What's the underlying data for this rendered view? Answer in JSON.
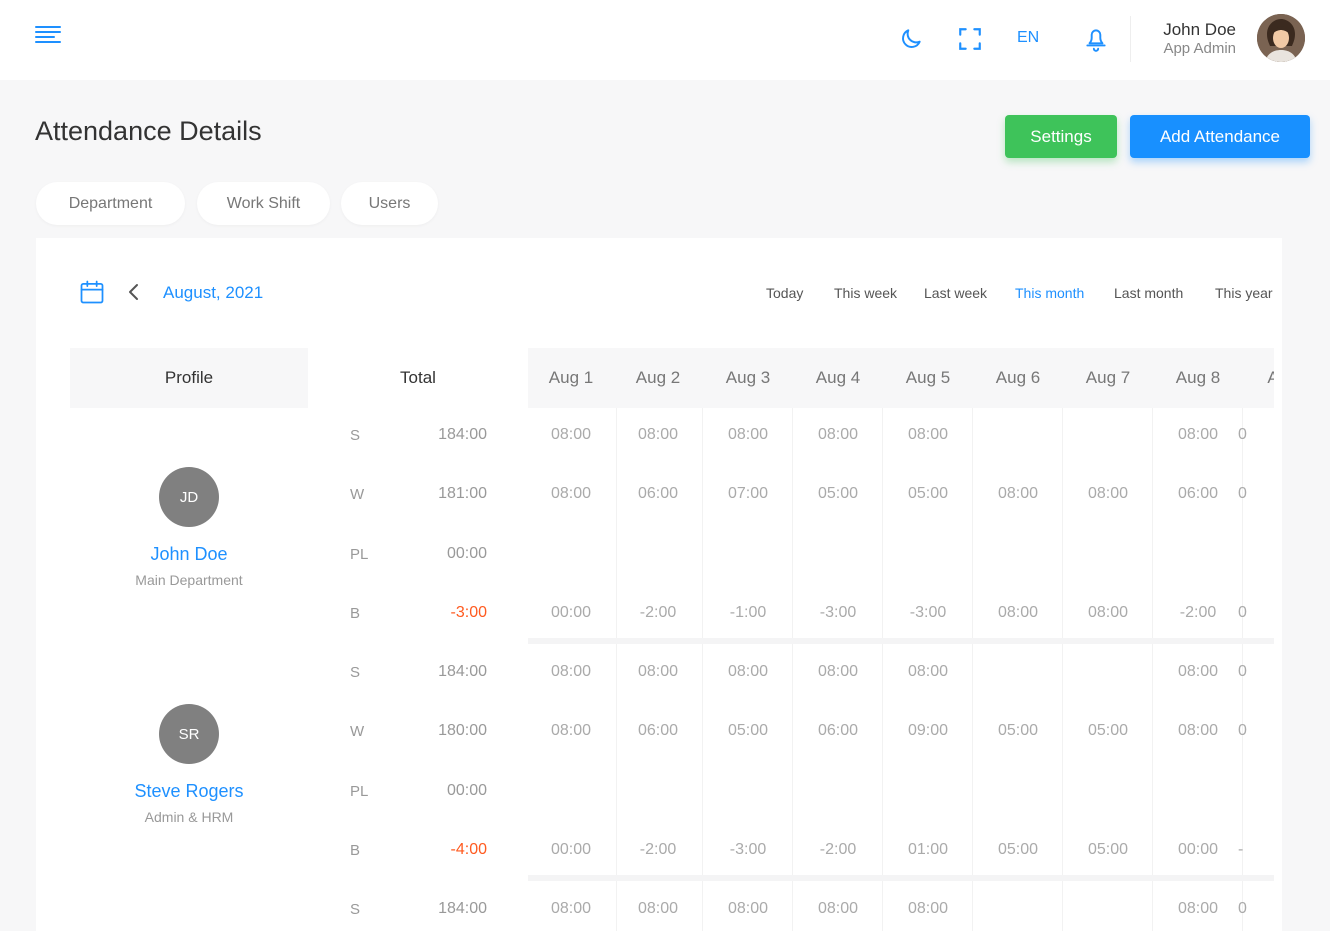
{
  "header": {
    "lang": "EN",
    "user_name": "John Doe",
    "user_role": "App Admin"
  },
  "page": {
    "title": "Attendance Details",
    "settings_label": "Settings",
    "add_label": "Add Attendance"
  },
  "filters": [
    "Department",
    "Work Shift",
    "Users"
  ],
  "calendar": {
    "month_label": "August, 2021",
    "periods": [
      "Today",
      "This week",
      "Last week",
      "This month",
      "Last month",
      "This year"
    ],
    "active_period": "This month"
  },
  "table": {
    "profile_header": "Profile",
    "total_header": "Total",
    "days": [
      "Aug 1",
      "Aug 2",
      "Aug 3",
      "Aug 4",
      "Aug 5",
      "Aug 6",
      "Aug 7",
      "Aug 8",
      "A"
    ],
    "users": [
      {
        "initials": "JD",
        "name": "John Doe",
        "department": "Main Department",
        "rows": [
          {
            "label": "S",
            "total": "184:00",
            "values": [
              "08:00",
              "08:00",
              "08:00",
              "08:00",
              "08:00",
              "",
              "",
              "08:00",
              "0"
            ]
          },
          {
            "label": "W",
            "total": "181:00",
            "values": [
              "08:00",
              "06:00",
              "07:00",
              "05:00",
              "05:00",
              "08:00",
              "08:00",
              "06:00",
              "0"
            ]
          },
          {
            "label": "PL",
            "total": "00:00",
            "values": [
              "",
              "",
              "",
              "",
              "",
              "",
              "",
              "",
              ""
            ]
          },
          {
            "label": "B",
            "total": "-3:00",
            "values": [
              "00:00",
              "-2:00",
              "-1:00",
              "-3:00",
              "-3:00",
              "08:00",
              "08:00",
              "-2:00",
              "0"
            ]
          }
        ]
      },
      {
        "initials": "SR",
        "name": "Steve Rogers",
        "department": "Admin & HRM",
        "rows": [
          {
            "label": "S",
            "total": "184:00",
            "values": [
              "08:00",
              "08:00",
              "08:00",
              "08:00",
              "08:00",
              "",
              "",
              "08:00",
              "0"
            ]
          },
          {
            "label": "W",
            "total": "180:00",
            "values": [
              "08:00",
              "06:00",
              "05:00",
              "06:00",
              "09:00",
              "05:00",
              "05:00",
              "08:00",
              "0"
            ]
          },
          {
            "label": "PL",
            "total": "00:00",
            "values": [
              "",
              "",
              "",
              "",
              "",
              "",
              "",
              "",
              ""
            ]
          },
          {
            "label": "B",
            "total": "-4:00",
            "values": [
              "00:00",
              "-2:00",
              "-3:00",
              "-2:00",
              "01:00",
              "05:00",
              "05:00",
              "00:00",
              "-"
            ]
          }
        ]
      },
      {
        "initials": "",
        "name": "",
        "department": "",
        "rows": [
          {
            "label": "S",
            "total": "184:00",
            "values": [
              "08:00",
              "08:00",
              "08:00",
              "08:00",
              "08:00",
              "",
              "",
              "08:00",
              "0"
            ]
          }
        ]
      }
    ]
  },
  "colors": {
    "accent": "#1e90ff",
    "success": "#3ec35a",
    "negative": "#ff5a1f"
  },
  "icons": [
    "menu-icon",
    "moon-icon",
    "fullscreen-icon",
    "bell-icon",
    "calendar-icon",
    "chevron-left-icon"
  ]
}
